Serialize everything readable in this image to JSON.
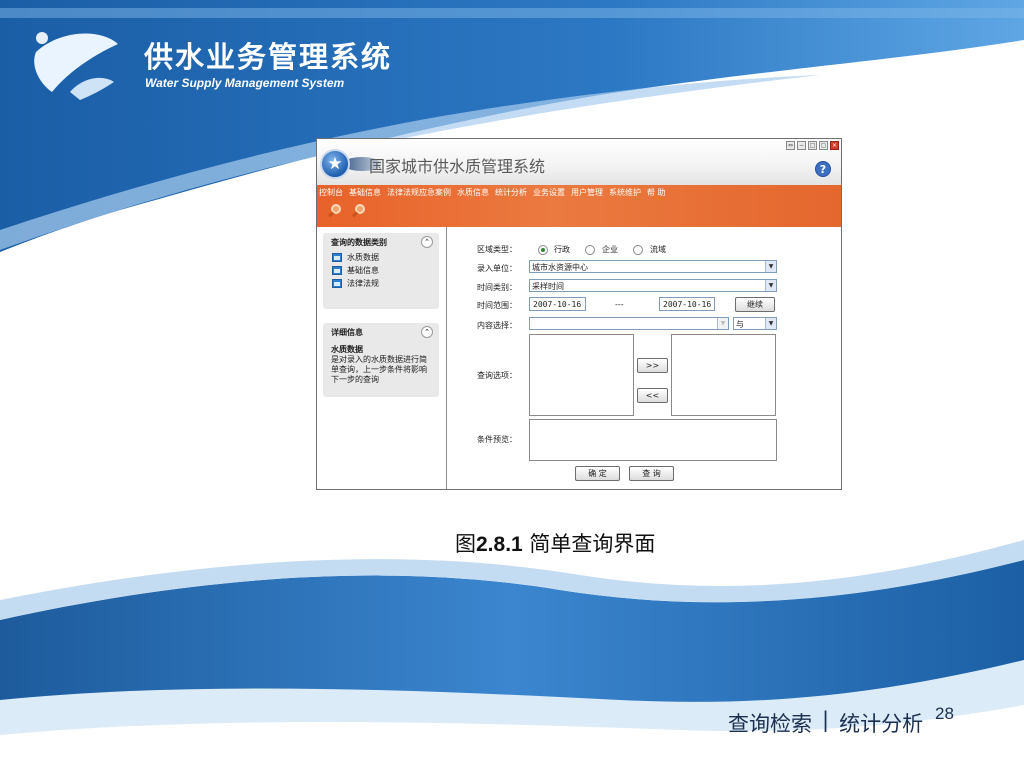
{
  "slide": {
    "title": "供水业务管理系统",
    "subtitle": "Water Supply Management System",
    "caption_prefix": "图",
    "caption_number": "2.8.1",
    "caption_text": "简单查询界面",
    "footer_link_1": "查询检索",
    "footer_separator": "|",
    "footer_link_2": "统计分析",
    "page_number": "28",
    "colors": {
      "deep_blue": "#1c5fa4",
      "light_blue": "#4d93d6",
      "orange": "#e8622a"
    }
  },
  "app": {
    "title": "国家城市供水质管理系统",
    "help_label": "?",
    "window_buttons": [
      "⇔",
      "−",
      "□",
      "▢",
      "×"
    ],
    "menu": [
      "控制台",
      "基础信息",
      "法律法规应急案例",
      "水质信息",
      "统计分析",
      "业务设置",
      "用户管理",
      "系统维护",
      "帮 助"
    ],
    "toolbar_icons": [
      "search-icon",
      "search-icon"
    ],
    "left_panel": {
      "query_header": "查询的数据类别",
      "query_items": [
        "水质数据",
        "基础信息",
        "法律法规"
      ],
      "detail_header": "详细信息",
      "detail_title": "水质数据",
      "detail_text": "是对录入的水质数据进行简单查询，上一步条件将影响下一步的查询",
      "collapse_icon": "⌃"
    },
    "form": {
      "region_type_label": "区域类型：",
      "region_options": [
        "行政",
        "企业",
        "流域"
      ],
      "region_selected": "行政",
      "unit_label": "录入单位：",
      "unit_value": "城市水资源中心",
      "time_type_label": "时间类别：",
      "time_type_value": "采样时间",
      "time_range_label": "时间范围：",
      "date_from": "2007-10-16",
      "date_sep": "---",
      "date_to": "2007-10-16",
      "continue_button": "继续",
      "content_label": "内容选择：",
      "content_value": "",
      "logic_value": "与",
      "query_options_label": "查询选项：",
      "move_right": ">>",
      "move_left": "<<",
      "preview_label": "条件预览：",
      "ok_button": "确 定",
      "query_button": "查 询"
    }
  }
}
